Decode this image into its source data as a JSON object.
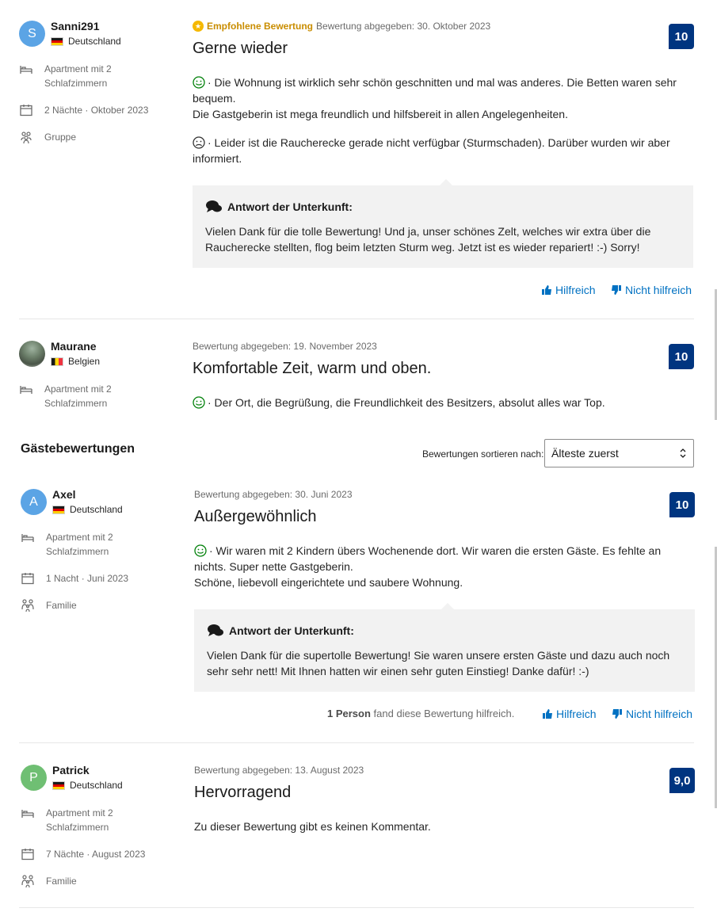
{
  "reviews": [
    {
      "initial": "S",
      "avatar_color": "#5ba4e5",
      "name": "Sanni291",
      "country": "Deutschland",
      "room": "Apartment mit 2 Schlafzimmern",
      "stay": "2 Nächte · Oktober 2023",
      "traveler": "Gruppe",
      "recommended": "Empfohlene Bewertung",
      "posted": "Bewertung abgegeben: 30. Oktober 2023",
      "title": "Gerne wieder",
      "score": "10",
      "positive": "· Die Wohnung ist wirklich sehr schön geschnitten und mal was anderes. Die Betten waren sehr bequem.",
      "positive2": "Die Gastgeberin ist mega freundlich und hilfsbereit in allen Angelegenheiten.",
      "negative": "· Leider ist die Raucherecke gerade nicht verfügbar (Sturmschaden). Darüber wurden wir aber informiert.",
      "reply_title": "Antwort der Unterkunft:",
      "reply": "Vielen Dank für die tolle Bewertung! Und ja, unser schönes Zelt, welches wir extra über die Raucherecke stellten, flog beim letzten Sturm weg. Jetzt ist es wieder repariert! :-) Sorry!",
      "helpful": "Hilfreich",
      "not_helpful": "Nicht hilfreich"
    },
    {
      "name": "Maurane",
      "country": "Belgien",
      "room": "Apartment mit 2 Schlafzimmern",
      "posted": "Bewertung abgegeben: 19. November 2023",
      "title": "Komfortable Zeit, warm und oben.",
      "score": "10",
      "positive": "· Der Ort, die Begrüßung, die Freundlichkeit des Besitzers, absolut alles war Top."
    },
    {
      "initial": "A",
      "avatar_color": "#5ba4e5",
      "name": "Axel",
      "country": "Deutschland",
      "room": "Apartment mit 2 Schlafzimmern",
      "stay": "1 Nacht · Juni 2023",
      "traveler": "Familie",
      "posted": "Bewertung abgegeben: 30. Juni 2023",
      "title": "Außergewöhnlich",
      "score": "10",
      "positive": "· Wir waren mit 2 Kindern übers Wochenende dort. Wir waren die ersten Gäste. Es fehlte an nichts. Super nette Gastgeberin.",
      "positive2": "Schöne, liebevoll eingerichtete und saubere Wohnung.",
      "reply_title": "Antwort der Unterkunft:",
      "reply": "Vielen Dank für die supertolle Bewertung! Sie waren unsere ersten Gäste und dazu auch noch sehr sehr nett! Mit Ihnen hatten wir einen sehr guten Einstieg! Danke dafür! :-)",
      "helpful_count_bold": "1 Person",
      "helpful_count_rest": "fand diese Bewertung hilfreich.",
      "helpful": "Hilfreich",
      "not_helpful": "Nicht hilfreich"
    },
    {
      "initial": "P",
      "avatar_color": "#6fbf73",
      "name": "Patrick",
      "country": "Deutschland",
      "room": "Apartment mit 2 Schlafzimmern",
      "stay": "7 Nächte · August 2023",
      "traveler": "Familie",
      "posted": "Bewertung abgegeben: 13. August 2023",
      "title": "Hervorragend",
      "score": "9,0",
      "no_comment": "Zu dieser Bewertung gibt es keinen Kommentar."
    }
  ],
  "section": {
    "title": "Gästebewertungen",
    "sort_label": "Bewertungen sortieren nach:",
    "sort_value": "Älteste zuerst"
  },
  "colors": {
    "score_bg": "#003580",
    "link": "#0071c2",
    "recommended": "#c98d00"
  }
}
